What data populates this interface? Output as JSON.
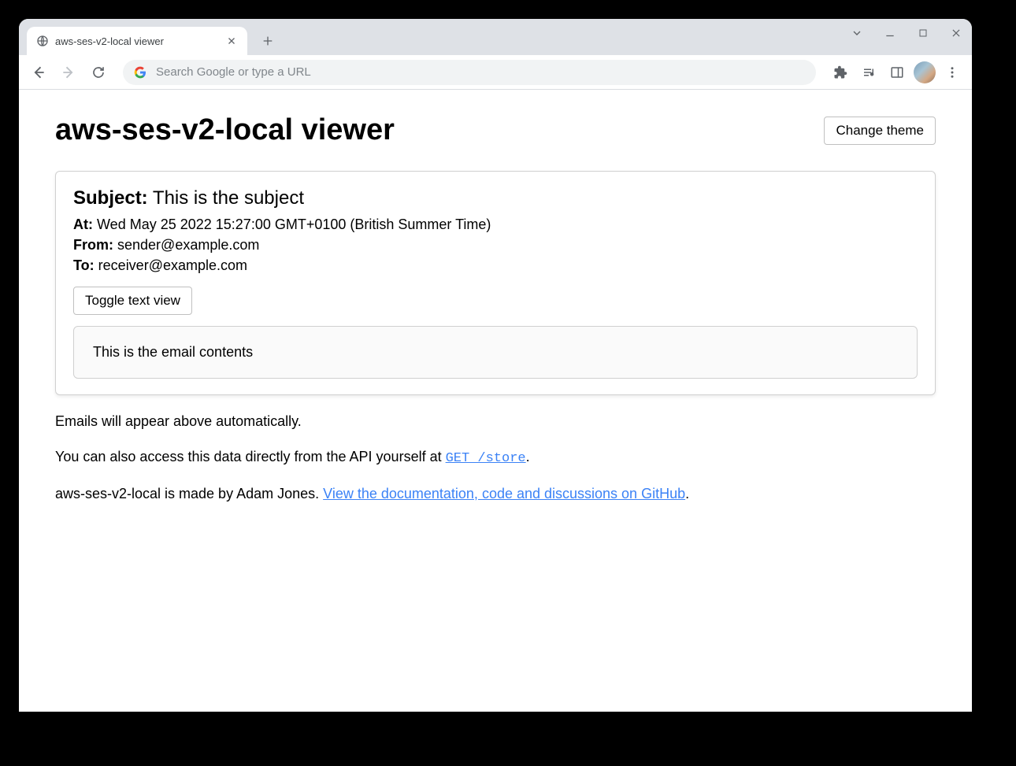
{
  "browser": {
    "tab_title": "aws-ses-v2-local viewer",
    "url_placeholder": "Search Google or type a URL"
  },
  "page": {
    "title": "aws-ses-v2-local viewer",
    "change_theme_label": "Change theme"
  },
  "email": {
    "subject_label": "Subject:",
    "subject_value": "This is the subject",
    "at_label": "At:",
    "at_value": "Wed May 25 2022 15:27:00 GMT+0100 (British Summer Time)",
    "from_label": "From:",
    "from_value": "sender@example.com",
    "to_label": "To:",
    "to_value": "receiver@example.com",
    "toggle_label": "Toggle text view",
    "body": "This is the email contents"
  },
  "footer": {
    "info1": "Emails will appear above automatically.",
    "info2_pre": "You can also access this data directly from the API yourself at ",
    "info2_code": "GET /store",
    "info2_post": ".",
    "info3_pre": "aws-ses-v2-local is made by Adam Jones. ",
    "info3_link": "View the documentation, code and discussions on GitHub",
    "info3_post": "."
  }
}
